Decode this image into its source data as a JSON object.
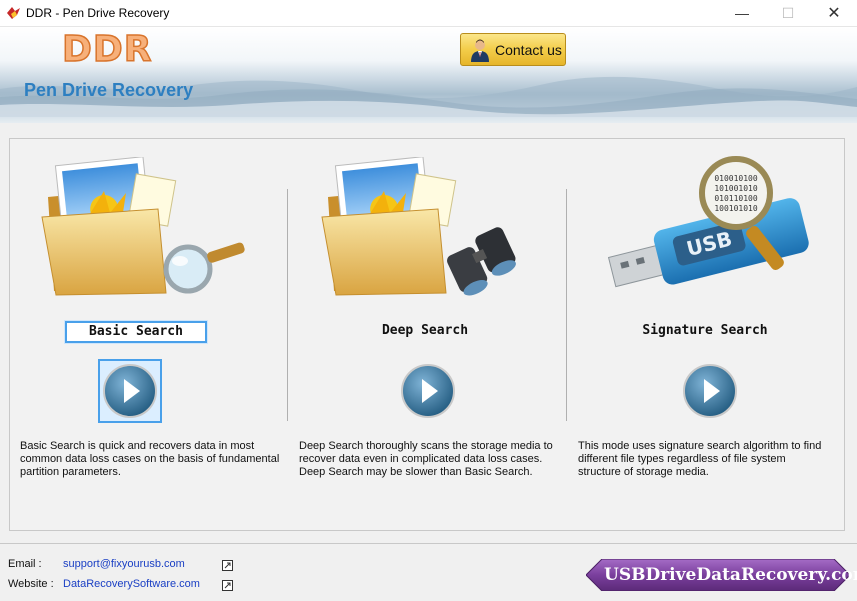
{
  "window": {
    "title": "DDR - Pen Drive Recovery",
    "icon": "ddr-app-icon",
    "controls": {
      "minimize": "—",
      "maximize": "☐",
      "close": "✕"
    }
  },
  "header": {
    "logo": "DDR",
    "product_name": "Pen Drive Recovery",
    "contact_label": "Contact us"
  },
  "modes": [
    {
      "label": "Basic Search",
      "selected": true,
      "illustration": "folder-with-magnifier",
      "description": "Basic Search is quick and recovers data in most common data loss cases on the basis of fundamental partition parameters."
    },
    {
      "label": "Deep Search",
      "selected": false,
      "illustration": "folder-with-binoculars",
      "description": "Deep Search thoroughly scans the storage media to recover data even in complicated data loss cases. Deep Search may be slower than Basic Search."
    },
    {
      "label": "Signature Search",
      "selected": false,
      "illustration": "usb-drive-with-magnifier",
      "description": "This mode uses signature search algorithm to find different file types regardless of file system structure of storage media."
    }
  ],
  "usb_label": "USB",
  "footer": {
    "email_label": "Email :",
    "email_link": "support@fixyourusb.com",
    "website_label": "Website :",
    "website_link": "DataRecoverySoftware.com",
    "badge": "USBDriveDataRecovery.com"
  },
  "colors": {
    "accent_blue": "#2d7fc1",
    "selection_blue": "#49a0ea",
    "contact_gold": "#f3cd4a",
    "badge_purple": "#7a3f9d",
    "link_blue": "#1a3fc4"
  }
}
